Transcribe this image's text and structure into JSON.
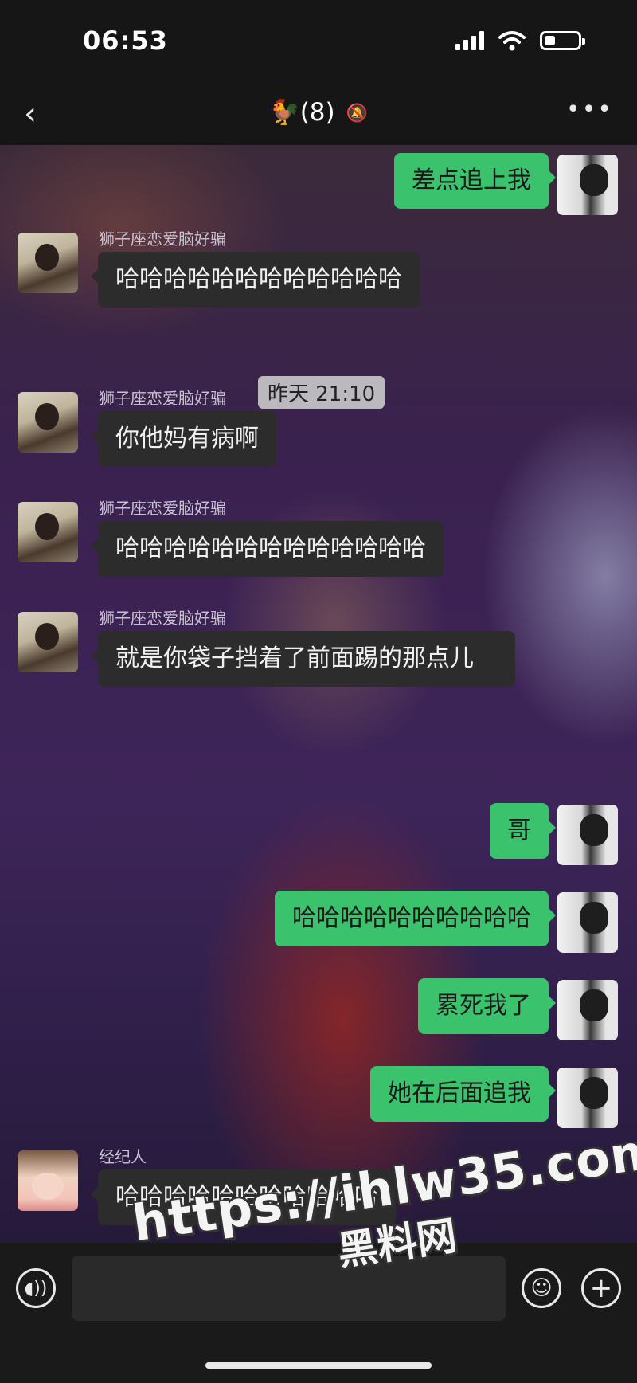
{
  "status_bar": {
    "time": "06:53"
  },
  "header": {
    "back": "‹",
    "title": "🐓(8)",
    "mute_icon": "🔕",
    "more": "•••"
  },
  "timestamp": "昨天 21:10",
  "messages": [
    {
      "side": "right",
      "text": "差点追上我"
    },
    {
      "side": "left",
      "sender": "狮子座恋爱脑好骗",
      "text": "哈哈哈哈哈哈哈哈哈哈哈哈"
    },
    {
      "side": "left",
      "sender": "狮子座恋爱脑好骗",
      "text": "你他妈有病啊"
    },
    {
      "side": "left",
      "sender": "狮子座恋爱脑好骗",
      "text": "哈哈哈哈哈哈哈哈哈哈哈哈哈"
    },
    {
      "side": "left",
      "sender": "狮子座恋爱脑好骗",
      "text": "就是你袋子挡着了前面踢的那点儿"
    },
    {
      "side": "right",
      "text": "哥"
    },
    {
      "side": "right",
      "text": "哈哈哈哈哈哈哈哈哈哈"
    },
    {
      "side": "right",
      "text": "累死我了"
    },
    {
      "side": "right",
      "text": "她在后面追我"
    },
    {
      "side": "left",
      "sender": "经纪人",
      "text": "哈哈哈哈哈哈哈哈哈哈哈"
    }
  ],
  "input_bar": {
    "voice_icon": "voice-icon",
    "emoji_icon": "emoji-icon",
    "plus_icon": "plus-icon"
  },
  "watermark": {
    "line1": "https://ihlw35.com",
    "line2": "黑料网"
  }
}
